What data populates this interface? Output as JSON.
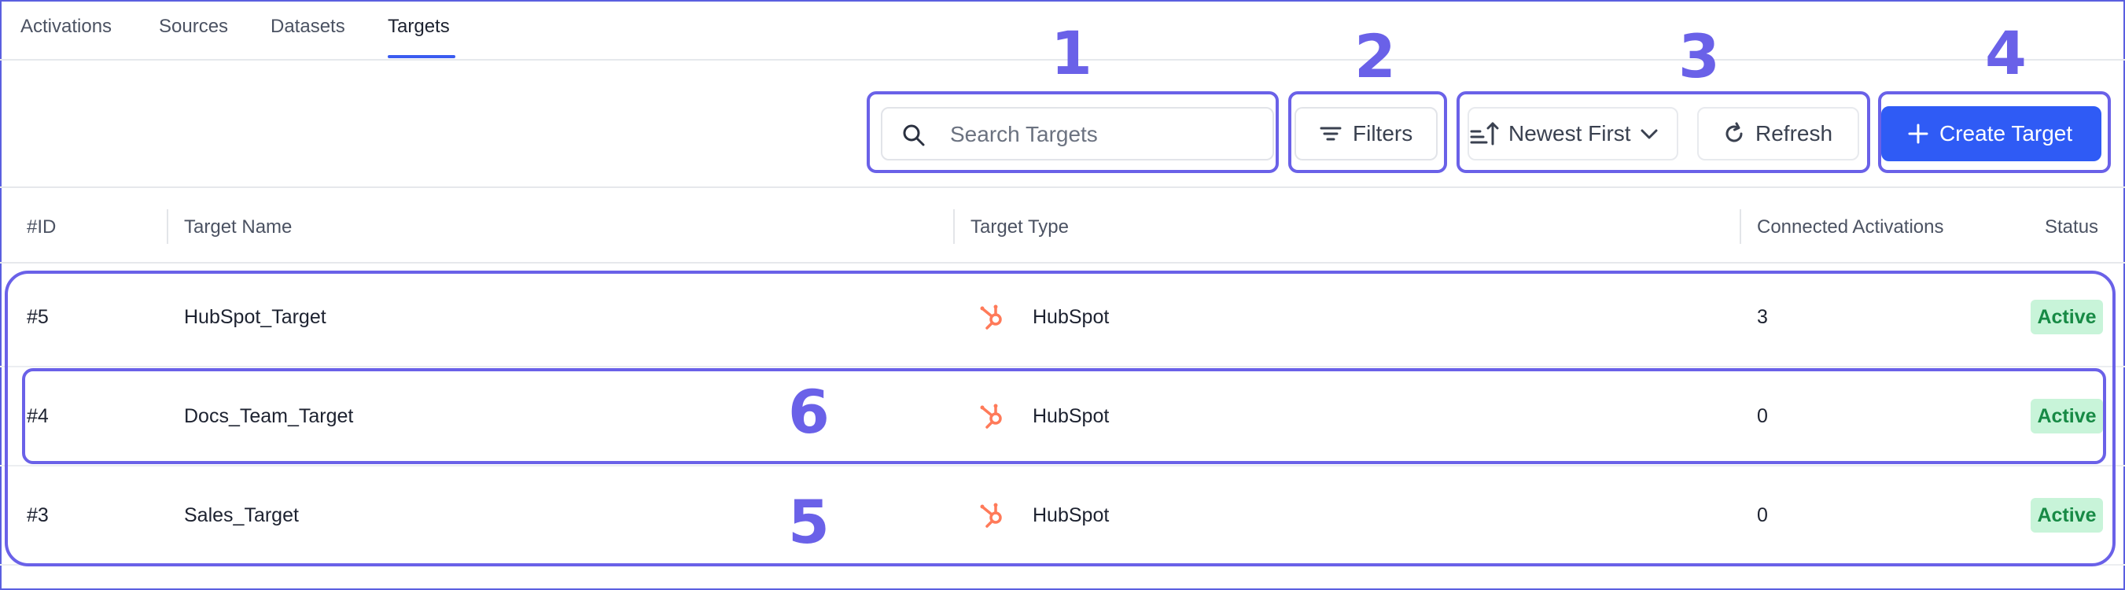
{
  "tabs": [
    {
      "label": "Activations"
    },
    {
      "label": "Sources"
    },
    {
      "label": "Datasets"
    },
    {
      "label": "Targets",
      "active": true
    }
  ],
  "toolbar": {
    "search_placeholder": "Search Targets",
    "filters_label": "Filters",
    "sort_label": "Newest First",
    "refresh_label": "Refresh",
    "create_label": "Create Target"
  },
  "table": {
    "columns": [
      "#ID",
      "Target Name",
      "Target Type",
      "Connected Activations",
      "Status"
    ],
    "rows": [
      {
        "id": "#5",
        "name": "HubSpot_Target",
        "type": "HubSpot",
        "connected": "3",
        "status": "Active"
      },
      {
        "id": "#4",
        "name": "Docs_Team_Target",
        "type": "HubSpot",
        "connected": "0",
        "status": "Active"
      },
      {
        "id": "#3",
        "name": "Sales_Target",
        "type": "HubSpot",
        "connected": "0",
        "status": "Active"
      }
    ]
  },
  "annotations": [
    "1",
    "2",
    "3",
    "4",
    "5",
    "6"
  ],
  "colors": {
    "accent": "#2f5bf5",
    "annotation": "#6a61e8",
    "status_bg": "#c8f4d9",
    "status_text": "#178a45",
    "hubspot": "#ff7a59"
  }
}
